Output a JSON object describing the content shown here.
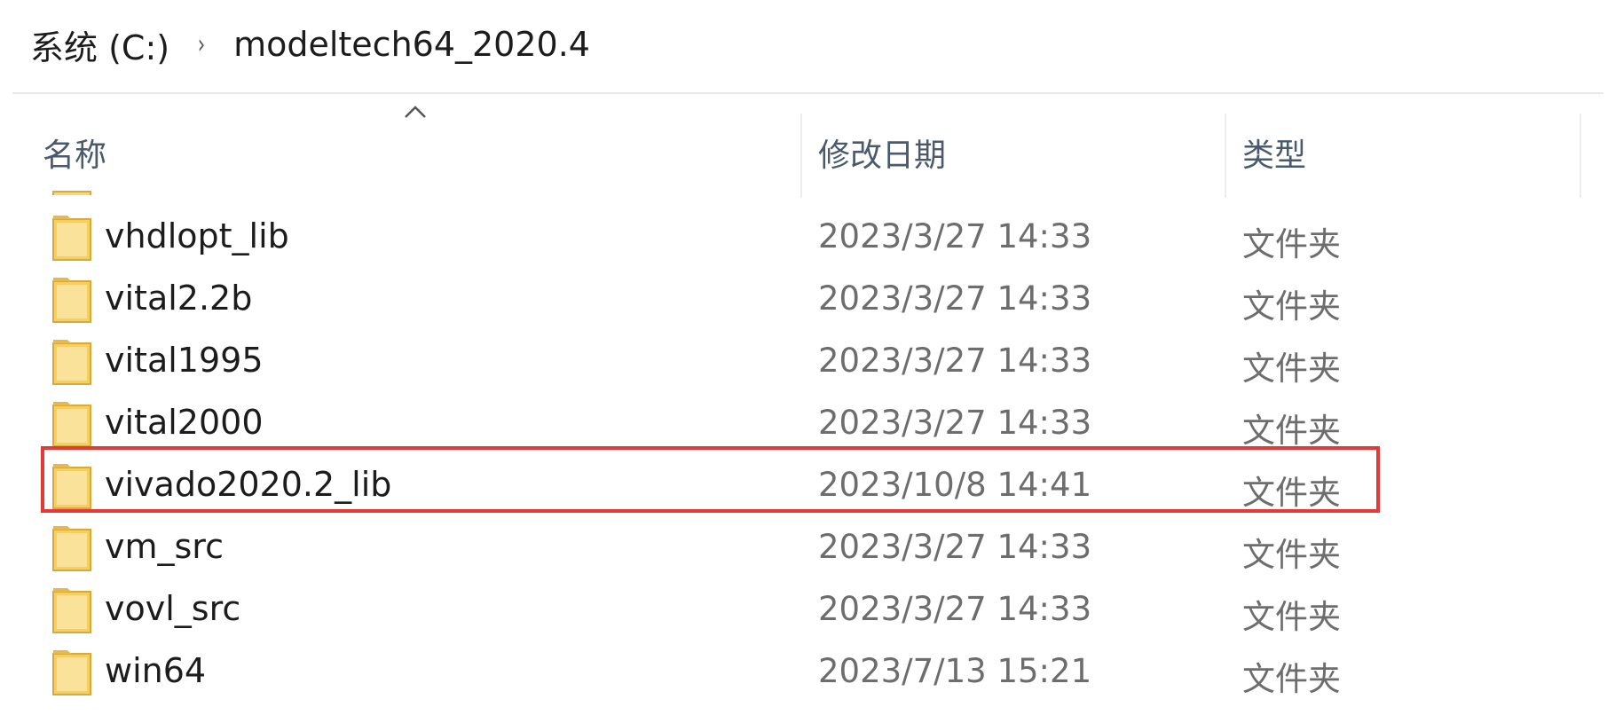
{
  "breadcrumb": {
    "items": [
      "系统 (C:)",
      "modeltech64_2020.4"
    ],
    "separator": "›"
  },
  "columns": {
    "name": "名称",
    "date": "修改日期",
    "type": "类型"
  },
  "rows": [
    {
      "name": "vhdlopt_lib",
      "date": "2023/3/27 14:33",
      "type": "文件夹"
    },
    {
      "name": "vital2.2b",
      "date": "2023/3/27 14:33",
      "type": "文件夹"
    },
    {
      "name": "vital1995",
      "date": "2023/3/27 14:33",
      "type": "文件夹"
    },
    {
      "name": "vital2000",
      "date": "2023/3/27 14:33",
      "type": "文件夹"
    },
    {
      "name": "vivado2020.2_lib",
      "date": "2023/10/8 14:41",
      "type": "文件夹",
      "highlighted": true
    },
    {
      "name": "vm_src",
      "date": "2023/3/27 14:33",
      "type": "文件夹"
    },
    {
      "name": "vovl_src",
      "date": "2023/3/27 14:33",
      "type": "文件夹"
    },
    {
      "name": "win64",
      "date": "2023/7/13 15:21",
      "type": "文件夹"
    }
  ],
  "icons": {
    "folder": "folder-icon",
    "sort": "sort-ascending-icon"
  },
  "colors": {
    "highlight": "#e53935",
    "folder": "#f8d775"
  }
}
